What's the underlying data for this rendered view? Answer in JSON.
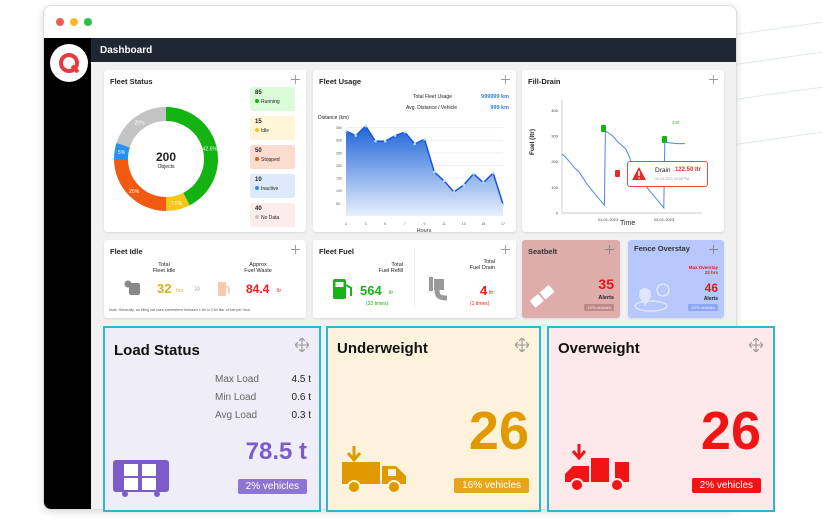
{
  "header": {
    "title": "Dashboard"
  },
  "fleet_status": {
    "title": "Fleet Status",
    "total": "200",
    "total_label": "Objects",
    "items": [
      {
        "count": "85",
        "label": "Running",
        "pct": "42.5%",
        "color": "#12b312",
        "bg": "#dcfcd9"
      },
      {
        "count": "15",
        "label": "Idle",
        "pct": "7.5%",
        "color": "#f5c518",
        "bg": "#fff6d9"
      },
      {
        "count": "50",
        "label": "Stopped",
        "pct": "25%",
        "color": "#f25a12",
        "bg": "#fddcd0"
      },
      {
        "count": "10",
        "label": "Inactive",
        "pct": "5%",
        "color": "#2d8ff0",
        "bg": "#dceafb"
      },
      {
        "count": "40",
        "label": "No Data",
        "pct": "20%",
        "color": "#c4c4c4",
        "bg": "#fdecec"
      }
    ]
  },
  "fleet_usage": {
    "title": "Fleet Usage",
    "total_label": "Total Fleet Usage",
    "total_value": "999999 km",
    "avg_label": "Avg. Distance / Vehicle",
    "avg_value": "999 km",
    "chart_data": {
      "type": "area",
      "ylabel": "Distance (km)",
      "xlabel": "Hours",
      "x": [
        1,
        2,
        3,
        4,
        5,
        6,
        7,
        8,
        9,
        10,
        11,
        12,
        13,
        14,
        15,
        16,
        17
      ],
      "values": [
        336,
        318,
        356,
        296,
        296,
        318,
        332,
        285,
        304,
        174,
        139,
        95,
        123,
        167,
        132,
        170,
        46
      ],
      "yticks": [
        50,
        100,
        150,
        200,
        250,
        300,
        350
      ],
      "xticks": [
        1,
        3,
        5,
        7,
        9,
        11,
        13,
        15,
        17
      ],
      "ylim": [
        0,
        380
      ]
    }
  },
  "fill_drain": {
    "title": "Fill-Drain",
    "tooltip_label": "Drain",
    "tooltip_value": "122.50 ltr",
    "tooltip_time": "02-03-2021 02:08 PM",
    "fill_label": "240",
    "chart_data": {
      "type": "line",
      "ylabel": "Fuel (ltr)",
      "xlabel": "Time",
      "xticks": [
        "01-01-2023",
        "02-01-2023"
      ],
      "yticks": [
        0,
        100,
        200,
        300,
        400
      ],
      "ylim": [
        0,
        440
      ],
      "values": [
        230,
        215,
        195,
        175,
        160,
        135,
        110,
        90,
        70,
        50,
        30,
        320,
        300,
        280,
        265,
        250,
        215,
        140,
        130,
        120,
        100,
        80,
        60,
        40,
        20,
        275,
        272,
        270,
        270,
        270
      ]
    }
  },
  "fleet_idle": {
    "title": "Fleet Idle",
    "total_label_1": "Total",
    "total_label_2": "Fleet Idle",
    "total_value": "32",
    "total_unit": "hrs",
    "waste_label_1": "Approx",
    "waste_label_2": "Fuel Waste",
    "waste_value": "84.4",
    "waste_unit": "ltr",
    "note": "Note: Generally, an idling car uses somewhere between 1.89 to 2.64 liter of fuel per hour."
  },
  "fleet_fuel": {
    "title": "Fleet Fuel",
    "refill_label_1": "Total",
    "refill_label_2": "Fuel Refill",
    "refill_value": "564",
    "refill_unit": "ltr",
    "refill_times": "(32 times)",
    "drain_label_1": "Total",
    "drain_label_2": "Fuel Drain",
    "drain_value": "4",
    "drain_unit": "ltr",
    "drain_times": "(1 times)"
  },
  "seatbelt": {
    "title": "Seatbelt",
    "value": "35",
    "label": "Alerts",
    "badge": "15% vehicles"
  },
  "fence": {
    "title": "Fence Overstay",
    "max_label": "Max Overstay",
    "max_value": "22 hrs",
    "value": "46",
    "label": "Alerts",
    "badge": "15% vehicles"
  },
  "load": {
    "title": "Load Status",
    "rows": [
      {
        "label": "Max Load",
        "value": "4.5 t"
      },
      {
        "label": "Min Load",
        "value": "0.6 t"
      },
      {
        "label": "Avg Load",
        "value": "0.3 t"
      }
    ],
    "value": "78.5 t",
    "badge": "2% vehicles"
  },
  "underweight": {
    "title": "Underweight",
    "value": "26",
    "badge": "16% vehicles"
  },
  "overweight": {
    "title": "Overweight",
    "value": "26",
    "badge": "2% vehicles"
  }
}
